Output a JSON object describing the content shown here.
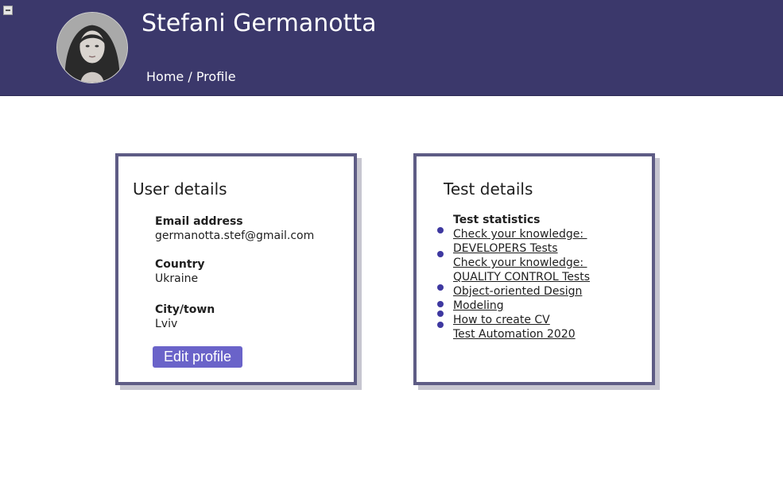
{
  "header": {
    "user_name": "Stefani Germanotta",
    "breadcrumb": {
      "home": "Home",
      "separator": " / ",
      "current": "Profile"
    }
  },
  "user_details": {
    "title": "User details",
    "email_label": "Email address",
    "email_value": "germanotta.stef@gmail.com",
    "country_label": "Country",
    "country_value": "Ukraine",
    "city_label": "City/town",
    "city_value": "Lviv",
    "edit_button": "Edit profile"
  },
  "test_details": {
    "title": "Test details",
    "stats_label": "Test statistics",
    "links": [
      {
        "line1": "Check your knowledge: ",
        "line2": "DEVELOPERS Tests"
      },
      {
        "line1": "Check your knowledge: ",
        "line2": "QUALITY CONTROL Tests"
      },
      {
        "line1": "Object-oriented Design"
      },
      {
        "line1": "Modeling"
      },
      {
        "line1": "How to create CV"
      },
      {
        "line1": "Test Automation 2020"
      }
    ]
  },
  "colors": {
    "header_bg": "#3b386b",
    "card_border": "#5e5c85",
    "button_bg": "#6a63c9",
    "bullet": "#3e38a0"
  },
  "icons": {
    "menu_toggle": "collapse-icon",
    "bullet": "bullet-dot-icon"
  }
}
